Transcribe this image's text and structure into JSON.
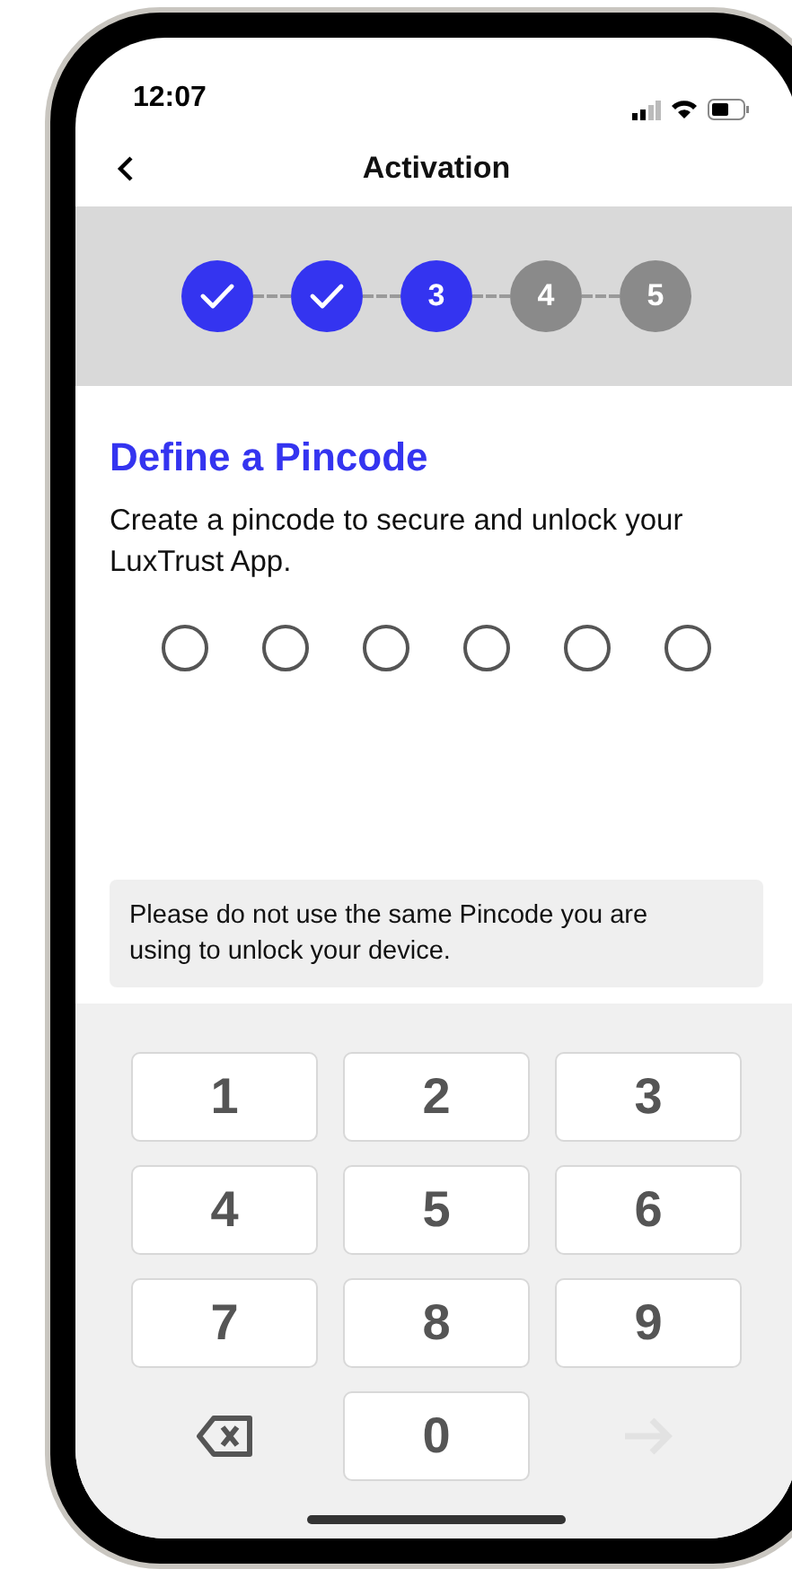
{
  "status_bar": {
    "time": "12:07"
  },
  "header": {
    "title": "Activation"
  },
  "steps": [
    {
      "completed": true,
      "current": false
    },
    {
      "completed": true,
      "current": false
    },
    {
      "label": "3",
      "completed": false,
      "current": true
    },
    {
      "label": "4",
      "completed": false,
      "current": false
    },
    {
      "label": "5",
      "completed": false,
      "current": false
    }
  ],
  "heading": "Define a Pincode",
  "description": "Create a pincode to secure and unlock your LuxTrust App.",
  "pin_dots": [
    {
      "filled": false
    },
    {
      "filled": false
    },
    {
      "filled": false
    },
    {
      "filled": false
    },
    {
      "filled": false
    },
    {
      "filled": false
    }
  ],
  "notice": "Please do not use the same Pincode you are using to unlock your device.",
  "keypad": [
    {
      "kind": "digit",
      "label": "1"
    },
    {
      "kind": "digit",
      "label": "2"
    },
    {
      "kind": "digit",
      "label": "3"
    },
    {
      "kind": "digit",
      "label": "4"
    },
    {
      "kind": "digit",
      "label": "5"
    },
    {
      "kind": "digit",
      "label": "6"
    },
    {
      "kind": "digit",
      "label": "7"
    },
    {
      "kind": "digit",
      "label": "8"
    },
    {
      "kind": "digit",
      "label": "9"
    },
    {
      "kind": "backspace"
    },
    {
      "kind": "digit",
      "label": "0"
    },
    {
      "kind": "submit",
      "disabled": true
    }
  ]
}
